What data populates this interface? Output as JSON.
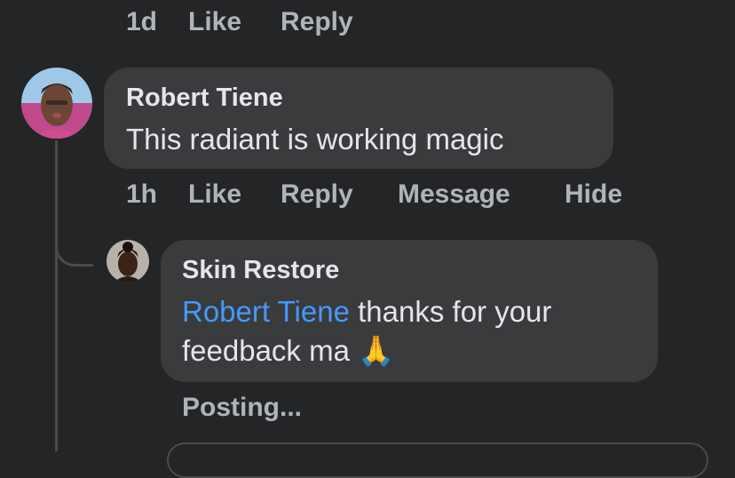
{
  "prev_comment_actions": {
    "time": "1d",
    "like": "Like",
    "reply": "Reply"
  },
  "comment": {
    "author": "Robert Tiene",
    "text": "This radiant is working magic",
    "actions": {
      "time": "1h",
      "like": "Like",
      "reply": "Reply",
      "message": "Message",
      "hide": "Hide"
    }
  },
  "reply": {
    "author": "Skin Restore",
    "mention": "Robert Tiene",
    "text_line1": "thanks for your",
    "text_line2": "feedback ma",
    "emoji": "🙏",
    "status": "Posting..."
  },
  "colors": {
    "background": "#242526",
    "bubble": "#3a3b3c",
    "text": "#e4e6eb",
    "muted": "#b0b3b8",
    "mention": "#4599ff"
  }
}
